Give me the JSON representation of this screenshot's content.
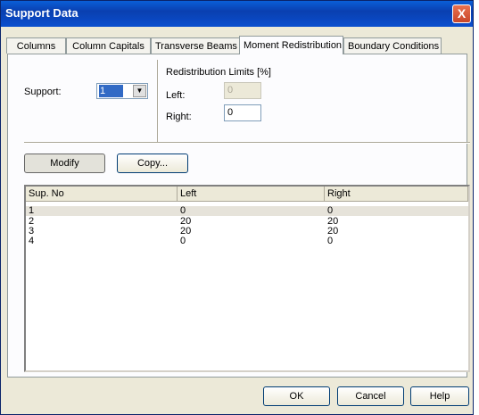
{
  "window": {
    "title": "Support Data",
    "close_glyph": "X"
  },
  "tabs": [
    "Columns",
    "Column Capitals",
    "Transverse Beams",
    "Moment Redistribution",
    "Boundary Conditions"
  ],
  "active_tab": "Moment Redistribution",
  "support": {
    "label": "Support:",
    "selected": "1",
    "arrow": "▼"
  },
  "limits": {
    "group_label": "Redistribution Limits [%]",
    "left_label": "Left:",
    "left_value": "0",
    "right_label": "Right:",
    "right_value": "0"
  },
  "buttons": {
    "modify": "Modify",
    "copy": "Copy...",
    "ok": "OK",
    "cancel": "Cancel",
    "help": "Help"
  },
  "table": {
    "headers": [
      "Sup. No",
      "Left",
      "Right"
    ],
    "rows": [
      [
        "1",
        "0",
        "0"
      ],
      [
        "2",
        "20",
        "20"
      ],
      [
        "3",
        "20",
        "20"
      ],
      [
        "4",
        "0",
        "0"
      ]
    ],
    "selected_row": 0
  },
  "colors": {
    "title_bar": "#0a4fd0",
    "dialog_bg": "#ece9d8",
    "close_button": "#d85a3a",
    "selection": "#316ac5"
  }
}
